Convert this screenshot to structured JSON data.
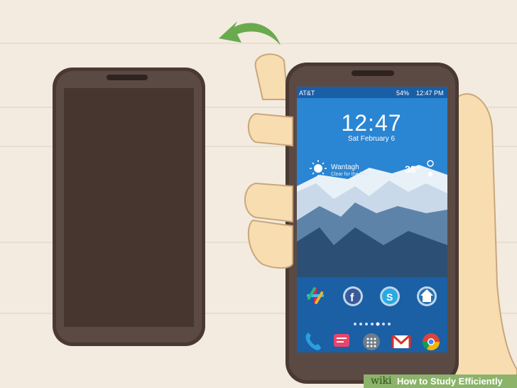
{
  "status_bar": {
    "carrier": "AT&T",
    "battery": "54%",
    "time": "12:47 PM"
  },
  "lockscreen": {
    "clock": "12:47",
    "date": "Sat February 6"
  },
  "weather": {
    "location": "Wantagh",
    "condition": "Clear for the hour",
    "temperature": "38°"
  },
  "dock_icons": [
    "slack-icon",
    "facebook-icon",
    "skype-icon",
    "home-icon"
  ],
  "bottom_icons": [
    "phone-icon",
    "messages-icon",
    "app-drawer-icon",
    "gmail-icon",
    "chrome-icon"
  ],
  "page_indicator": {
    "pages": 7,
    "active": 4
  },
  "watermark": {
    "site": "wiki",
    "title": "How to Study Efficiently"
  },
  "colors": {
    "background": "#f3ebe0",
    "phone_body": "#5a4a44",
    "screen_off": "#4b3b35",
    "sky": "#2c7bc6",
    "skin": "#f7ddb0",
    "arrow": "#6aaa4f",
    "banner": "#8cb36a"
  }
}
